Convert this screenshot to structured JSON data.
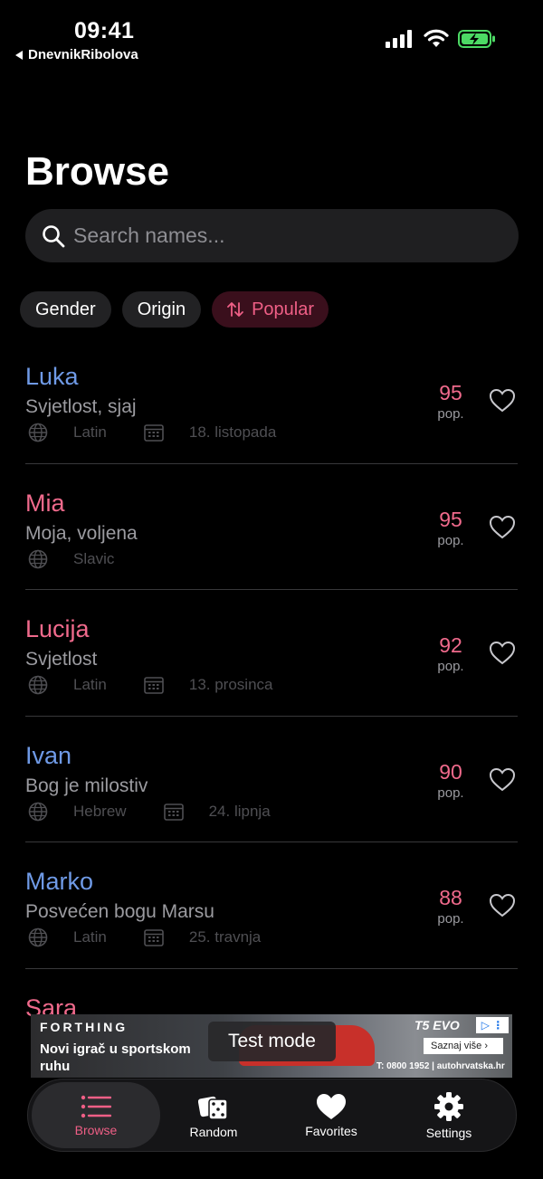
{
  "status": {
    "time": "09:41",
    "back_app": "DnevnikRibolova"
  },
  "page": {
    "title": "Browse"
  },
  "search": {
    "placeholder": "Search names..."
  },
  "filters": {
    "gender": "Gender",
    "origin": "Origin",
    "sort": "Popular"
  },
  "names": [
    {
      "name": "Luka",
      "gender": "m",
      "meaning": "Svjetlost, sjaj",
      "origin": "Latin",
      "date": "18. listopada",
      "score": "95",
      "score_label": "pop."
    },
    {
      "name": "Mia",
      "gender": "f",
      "meaning": "Moja, voljena",
      "origin": "Slavic",
      "date": "",
      "score": "95",
      "score_label": "pop."
    },
    {
      "name": "Lucija",
      "gender": "f",
      "meaning": "Svjetlost",
      "origin": "Latin",
      "date": "13. prosinca",
      "score": "92",
      "score_label": "pop."
    },
    {
      "name": "Ivan",
      "gender": "m",
      "meaning": "Bog je milostiv",
      "origin": "Hebrew",
      "date": "24. lipnja",
      "score": "90",
      "score_label": "pop."
    },
    {
      "name": "Marko",
      "gender": "m",
      "meaning": "Posvećen bogu Marsu",
      "origin": "Latin",
      "date": "25. travnja",
      "score": "88",
      "score_label": "pop."
    },
    {
      "name": "Sara",
      "gender": "f"
    }
  ],
  "ad": {
    "brand": "FORTHING",
    "headline": "Novi igrač u sportskom ruhu",
    "model": "T5 EVO",
    "cta": "Saznaj više",
    "phone": "T: 0800 1952 | autohrvatska.hr",
    "test_mode": "Test mode"
  },
  "tabs": [
    {
      "label": "Browse",
      "icon": "list-icon",
      "active": true
    },
    {
      "label": "Random",
      "icon": "dice-icon"
    },
    {
      "label": "Favorites",
      "icon": "heart-icon"
    },
    {
      "label": "Settings",
      "icon": "gear-icon"
    }
  ],
  "colors": {
    "male": "#6f9ae6",
    "female": "#f06a8c",
    "accent": "#ef5f86"
  }
}
